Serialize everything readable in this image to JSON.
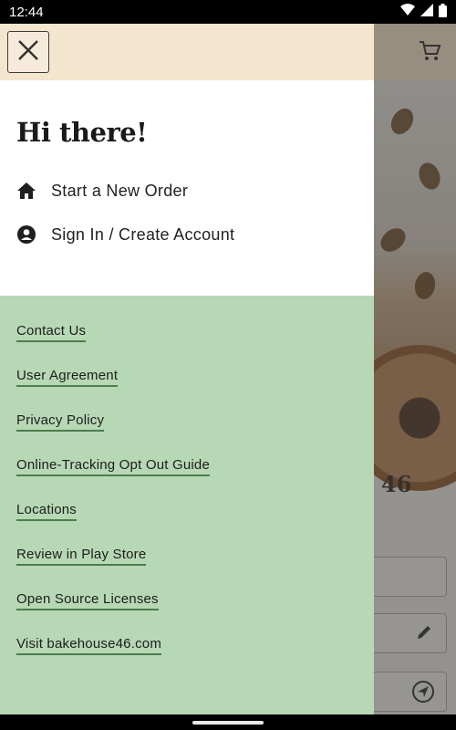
{
  "status_bar": {
    "time": "12:44"
  },
  "background": {
    "brand_number": "46"
  },
  "drawer": {
    "greeting": "Hi there!",
    "menu": [
      {
        "label": "Start a New Order",
        "icon": "home-icon"
      },
      {
        "label": "Sign In / Create Account",
        "icon": "account-circle-icon"
      }
    ],
    "links": [
      "Contact Us",
      "User Agreement",
      "Privacy Policy",
      "Online-Tracking Opt Out Guide",
      "Locations",
      "Review in Play Store",
      "Open Source Licenses",
      "Visit bakehouse46.com"
    ]
  },
  "colors": {
    "header_bg": "#f4e5cf",
    "links_bg": "#b7d8b4",
    "link_underline": "#4c7d4f"
  }
}
